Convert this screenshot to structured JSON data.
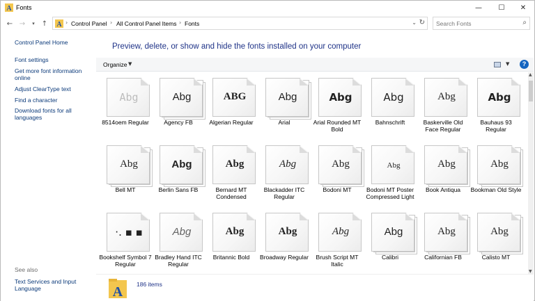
{
  "window": {
    "title": "Fonts"
  },
  "address": {
    "crumbs": [
      "Control Panel",
      "All Control Panel Items",
      "Fonts"
    ],
    "search_placeholder": "Search Fonts"
  },
  "left_pane": {
    "links": [
      "Control Panel Home",
      "Font settings",
      "Get more font information online",
      "Adjust ClearType text",
      "Find a character",
      "Download fonts for all languages"
    ],
    "see_also_label": "See also",
    "see_also_links": [
      "Text Services and Input Language"
    ]
  },
  "main": {
    "heading": "Preview, delete, or show and hide the fonts installed on your computer",
    "toolbar": {
      "organize_label": "Organize"
    }
  },
  "fonts": [
    {
      "name": "8514oem Regular",
      "sample": "Abg",
      "family": "DejaVu Sans Mono",
      "faded": true,
      "stack": false
    },
    {
      "name": "Agency FB",
      "sample": "Abg",
      "family": "Liberation Sans",
      "stack": true
    },
    {
      "name": "Algerian Regular",
      "sample": "ABG",
      "family": "Liberation Serif",
      "bold": true,
      "stack": false
    },
    {
      "name": "Arial",
      "sample": "Abg",
      "family": "Liberation Sans",
      "stack": true
    },
    {
      "name": "Arial Rounded MT Bold",
      "sample": "Abg",
      "family": "DejaVu Sans",
      "bold": true,
      "stack": false
    },
    {
      "name": "Bahnschrift",
      "sample": "Abg",
      "family": "DejaVu Sans",
      "stack": false
    },
    {
      "name": "Baskerville Old Face Regular",
      "sample": "Abg",
      "family": "Liberation Serif",
      "stack": false
    },
    {
      "name": "Bauhaus 93 Regular",
      "sample": "Abg",
      "family": "DejaVu Sans",
      "bold": true,
      "stack": false
    },
    {
      "name": "Bell MT",
      "sample": "Abg",
      "family": "Liberation Serif",
      "stack": true
    },
    {
      "name": "Berlin Sans FB",
      "sample": "Abg",
      "family": "Liberation Sans",
      "bold": true,
      "stack": true
    },
    {
      "name": "Bernard MT Condensed",
      "sample": "Abg",
      "family": "Liberation Serif",
      "bold": true,
      "stack": false
    },
    {
      "name": "Blackadder ITC Regular",
      "sample": "Abg",
      "family": "Liberation Serif",
      "italic": true,
      "stack": false
    },
    {
      "name": "Bodoni MT",
      "sample": "Abg",
      "family": "Liberation Serif",
      "stack": true
    },
    {
      "name": "Bodoni MT Poster Compressed Light",
      "sample": "Abg",
      "family": "Liberation Serif",
      "small": true,
      "stack": false
    },
    {
      "name": "Book Antiqua",
      "sample": "Abg",
      "family": "Liberation Serif",
      "stack": true
    },
    {
      "name": "Bookman Old Style",
      "sample": "Abg",
      "family": "Liberation Serif",
      "stack": true
    },
    {
      "name": "Bookshelf Symbol 7 Regular",
      "sample": "·.  ▪  ▪",
      "family": "DejaVu Sans",
      "stack": false
    },
    {
      "name": "Bradley Hand ITC Regular",
      "sample": "Abg",
      "family": "Liberation Sans",
      "italic": true,
      "light": true,
      "stack": false
    },
    {
      "name": "Britannic Bold",
      "sample": "Abg",
      "family": "Liberation Serif",
      "bold": true,
      "stack": false
    },
    {
      "name": "Broadway Regular",
      "sample": "Abg",
      "family": "Liberation Serif",
      "bold": true,
      "stack": false
    },
    {
      "name": "Brush Script MT Italic",
      "sample": "Abg",
      "family": "Liberation Serif",
      "italic": true,
      "stack": false
    },
    {
      "name": "Calibri",
      "sample": "Abg",
      "family": "Liberation Sans",
      "stack": true
    },
    {
      "name": "Californian FB",
      "sample": "Abg",
      "family": "Liberation Serif",
      "stack": true
    },
    {
      "name": "Calisto MT",
      "sample": "Abg",
      "family": "Liberation Serif",
      "stack": true
    }
  ],
  "status": {
    "count": "186 items"
  }
}
